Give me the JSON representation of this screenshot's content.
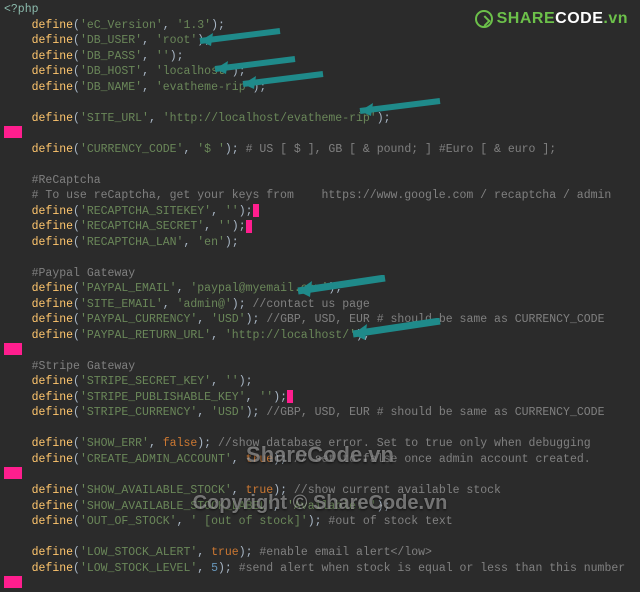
{
  "open_tag": "<?php",
  "pad": "    ",
  "l": {
    "ver": "define('eC_Version', '1.3');",
    "user": "define('DB_USER', 'root');",
    "pass": "define('DB_PASS', '');",
    "host": "define('DB_HOST', 'localhost');",
    "name": "define('DB_NAME', 'evatheme-rip');",
    "site": "define('SITE_URL', 'http://localhost/evatheme-rip');",
    "curr": "define('CURRENCY_CODE', '$ '); # US [ $ ], GB [ & pound; ] #Euro [ & euro ];",
    "rcH": "#ReCaptcha",
    "rcC": "# To use reCaptcha, get your keys from    https://www.google.com / recaptcha / admin",
    "rc1": "define('RECAPTCHA_SITEKEY', '');",
    "rc2": "define('RECAPTCHA_SECRET', '');",
    "rc3": "define('RECAPTCHA_LAN', 'en');",
    "ppH": "#Paypal Gateway",
    "pp1": "define('PAYPAL_EMAIL', 'paypal@myemail.com');",
    "pp2": "define('SITE_EMAIL', 'admin@'); //contact us page",
    "pp3": "define('PAYPAL_CURRENCY', 'USD'); //GBP, USD, EUR # should be same as CURRENCY_CODE",
    "pp4": "define('PAYPAL_RETURN_URL', 'http://localhost/');",
    "stH": "#Stripe Gateway",
    "st1": "define('STRIPE_SECRET_KEY', '');",
    "st2": "define('STRIPE_PUBLISHABLE_KEY', '');",
    "st3": "define('STRIPE_CURRENCY', 'USD'); //GBP, USD, EUR # should be same as CURRENCY_CODE",
    "se": "define('SHOW_ERR', false); //show database error. Set to true only when debugging",
    "caa": "define('CREATE_ADMIN_ACCOUNT', true); // set to false once admin account created.",
    "sas": "define('SHOW_AVAILABLE_STOCK', true); //show current available stock",
    "sal": "define('SHOW_AVAILABLE_STOCK_LABEL', 'Available: ');",
    "oos": "define('OUT_OF_STOCK', ' [out of stock]'); #out of stock text",
    "lsa": "define('LOW_STOCK_ALERT', true); #enable email alert</low>",
    "lsl": "define('LOW_STOCK_LEVEL', 5); #send alert when stock is equal or less than this number"
  },
  "watermark": {
    "brand_share": "SHARE",
    "brand_code": "CODE",
    "brand_suffix": ".vn",
    "center1": "ShareCode.vn",
    "center2": "Copyright © ShareCode.vn"
  }
}
